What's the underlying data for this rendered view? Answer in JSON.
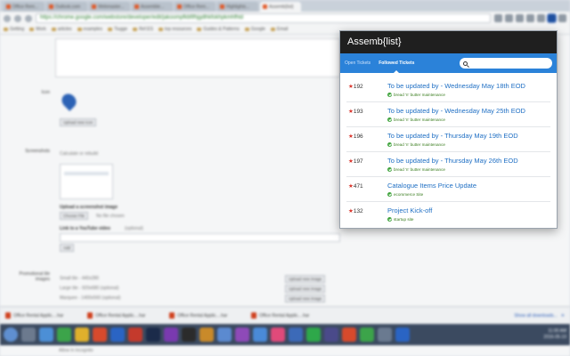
{
  "browser": {
    "url": "https://chrome.google.com/webstore/developer/edit/jakoompfkbfifhjgdlhkfokhpkmhfhtd",
    "tabs": [
      "Office Rem...",
      "Outlook.com",
      "Webmaster...",
      "Assemble...",
      "Office Rem...",
      "Highlights...",
      "Assemb{list}"
    ],
    "active_tab_index": 6
  },
  "bookmarks": [
    "Getting",
    "Work",
    "articles",
    "examples",
    "Tiugge",
    "Ref.ES",
    "top resources",
    "Guides & Patterns",
    "Google",
    "Email"
  ],
  "page": {
    "icon_label": "Icon",
    "upload_icon_button": "Upload new icon",
    "screenshots_label": "Screenshots",
    "screenshot_hint": "Calculate or rebuild",
    "upload_screenshot_label": "Upload a screenshot image",
    "choose_file_button": "Choose File",
    "no_file_text": "No file chosen",
    "youtube_label": "Link to a YouTube video",
    "youtube_optional": "(optional)",
    "add_button": "Add",
    "promo_label": "Promotional tile images",
    "promo_rows": [
      {
        "text": "Small tile - 440x280",
        "button": "Upload new image"
      },
      {
        "text": "Large tile - 920x680 (optional)",
        "button": "Upload new image"
      },
      {
        "text": "Marquee - 1400x560 (optional)",
        "button": "Upload new image"
      }
    ]
  },
  "downloads": {
    "items": [
      "Office Rental Applic....har",
      "Office Rental Applic....har",
      "Office Rental Applic....har",
      "Office Rental Applic....har"
    ],
    "show_all": "Show all downloads..."
  },
  "taskbar": {
    "time": "11:00 AM",
    "date": "2016-05-10"
  },
  "below_taskbar": "Allow in incognito",
  "popup": {
    "title": "Assemb{list}",
    "tabs": [
      {
        "label": "Open Tickets",
        "active": false
      },
      {
        "label": "Followed Tickets",
        "active": true
      }
    ],
    "search_placeholder": "",
    "tickets": [
      {
        "id": "192",
        "title": "To be updated by - Wednesday May 18th EOD",
        "tag": "bread 'n' butter maintenance"
      },
      {
        "id": "193",
        "title": "To be updated by - Wednesday May 25th EOD",
        "tag": "bread 'n' butter maintenance"
      },
      {
        "id": "196",
        "title": "To be updated by - Thursday May 19th EOD",
        "tag": "bread 'n' butter maintenance"
      },
      {
        "id": "197",
        "title": "To be updated by - Thursday May 26th EOD",
        "tag": "bread 'n' butter maintenance"
      },
      {
        "id": "471",
        "title": "Catalogue Items Price Update",
        "tag": "ecommerce Site"
      },
      {
        "id": "132",
        "title": "Project Kick-off",
        "tag": "startup site"
      }
    ]
  },
  "colors": {
    "popup_header_bg": "#1f1f1f",
    "popup_tabbar_bg": "#2b82d9",
    "link_blue": "#1f6fc4",
    "star_red": "#d9342b",
    "tag_green": "#3a7d1f"
  }
}
